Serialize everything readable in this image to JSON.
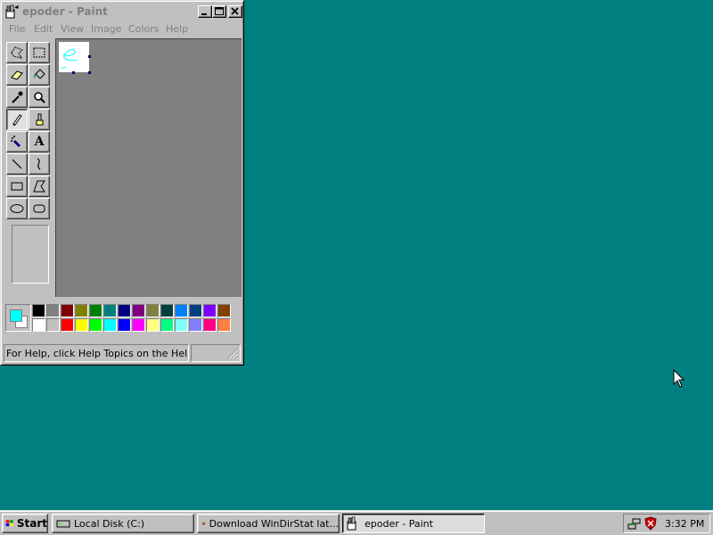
{
  "window": {
    "title": "epoder - Paint",
    "minimize_label": "_",
    "maximize_label": "□",
    "close_label": "✕"
  },
  "menu": [
    "File",
    "Edit",
    "View",
    "Image",
    "Colors",
    "Help"
  ],
  "tools": [
    "free-form-select-icon",
    "select-icon",
    "eraser-icon",
    "fill-icon",
    "pick-color-icon",
    "magnifier-icon",
    "pencil-icon",
    "brush-icon",
    "airbrush-icon",
    "text-icon",
    "line-icon",
    "curve-icon",
    "rectangle-icon",
    "polygon-icon",
    "ellipse-icon",
    "rounded-rectangle-icon"
  ],
  "text_tool_glyph": "A",
  "colors": {
    "foreground": "#00ffff",
    "background": "#ffffff",
    "palette_top": [
      "#000000",
      "#808080",
      "#800000",
      "#808000",
      "#008000",
      "#008080",
      "#000080",
      "#800080",
      "#808040",
      "#004040",
      "#0080ff",
      "#004080",
      "#8000ff",
      "#804000"
    ],
    "palette_bottom": [
      "#ffffff",
      "#c0c0c0",
      "#ff0000",
      "#ffff00",
      "#00ff00",
      "#00ffff",
      "#0000ff",
      "#ff00ff",
      "#ffff80",
      "#00ff80",
      "#80ffff",
      "#8080ff",
      "#ff0080",
      "#ff8040"
    ]
  },
  "status": {
    "help_text": "For Help, click Help Topics on the Help Men"
  },
  "taskbar": {
    "start_label": "Start",
    "tasks": [
      {
        "label": "Local Disk (C:)",
        "icon": "drive-icon",
        "pressed": false
      },
      {
        "label": "Download WinDirStat lat...",
        "icon": "firefox-icon",
        "pressed": false
      },
      {
        "label": "epoder - Paint",
        "icon": "paint-icon",
        "pressed": true
      }
    ],
    "clock": "3:32 PM",
    "tray_icons": [
      "network-icon",
      "security-shield-icon"
    ]
  }
}
